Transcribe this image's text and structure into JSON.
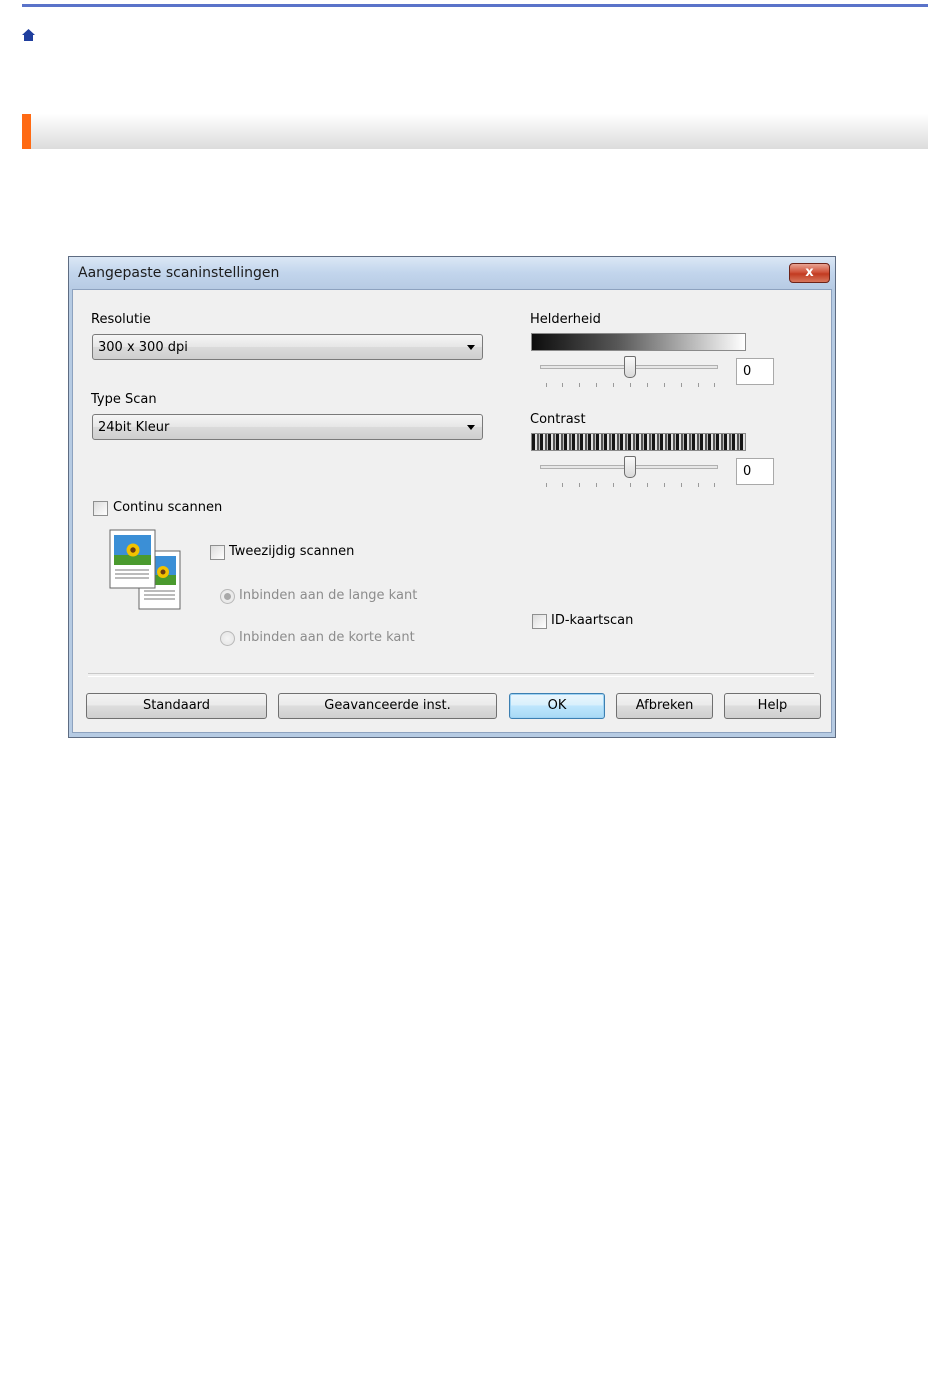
{
  "page": {
    "home_icon": "home-icon",
    "accent_color": "#ff6a13",
    "link_color": "#1f3e9e"
  },
  "dialog": {
    "title": "Aangepaste scaninstellingen",
    "close_glyph": "x",
    "resolution": {
      "label": "Resolutie",
      "value": "300 x 300 dpi"
    },
    "scan_type": {
      "label": "Type Scan",
      "value": "24bit Kleur"
    },
    "brightness": {
      "label": "Helderheid",
      "value": "0"
    },
    "contrast": {
      "label": "Contrast",
      "value": "0"
    },
    "continuous_scan": {
      "label": "Continu scannen",
      "checked": false
    },
    "duplex": {
      "label": "Tweezijdig scannen",
      "checked": false,
      "options": [
        {
          "label": "Inbinden aan de lange kant",
          "selected": true
        },
        {
          "label": "Inbinden aan de korte kant",
          "selected": false
        }
      ]
    },
    "id_card": {
      "label": "ID-kaartscan",
      "checked": false
    },
    "buttons": {
      "default": "Standaard",
      "advanced": "Geavanceerde inst.",
      "ok": "OK",
      "cancel": "Afbreken",
      "help": "Help"
    }
  }
}
